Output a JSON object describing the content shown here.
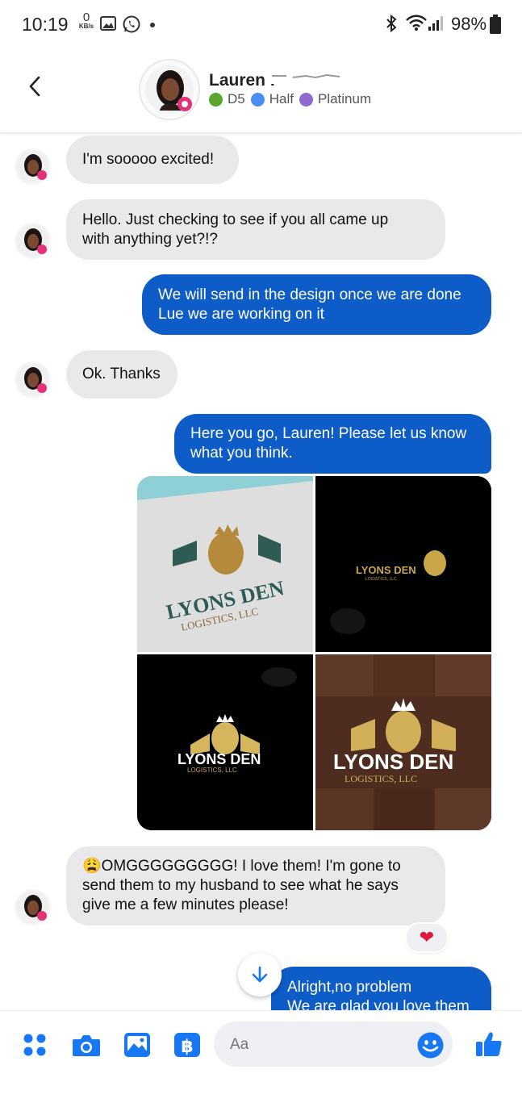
{
  "status_bar": {
    "time": "10:19",
    "net_speed_value": "0",
    "net_speed_unit": "KB/s",
    "battery": "98%"
  },
  "header": {
    "name": "Lauren I",
    "badges": [
      {
        "label": "D5",
        "color": "#58a62c"
      },
      {
        "label": "Half",
        "color": "#4c8df5"
      },
      {
        "label": "Platinum",
        "color": "#8f69d0"
      }
    ]
  },
  "messages": [
    {
      "dir": "in",
      "text": "I'm sooooo excited!"
    },
    {
      "dir": "in",
      "text": "Hello. Just checking to see if you all came up\nwith anything yet?!?"
    },
    {
      "dir": "out",
      "text": "We will send in the design once we are done\nLue we are working on it"
    },
    {
      "dir": "in",
      "text": "Ok. Thanks"
    },
    {
      "dir": "out",
      "text": "Here you go, Lauren! Please let us know\nwhat you think."
    },
    {
      "dir": "in",
      "text": "😩OMGGGGGGGGG! I love them! I'm gone to\nsend them to my husband to see what he says\ngive me a few minutes please!"
    },
    {
      "dir": "out",
      "text": "Alright,no problem\nWe are glad you love them"
    }
  ],
  "photos": {
    "brand_main": "LYONS DEN",
    "brand_sub": "LOGISTICS, LLC"
  },
  "reaction": "❤",
  "composer": {
    "placeholder": "Aa"
  },
  "colors": {
    "outgoing": "#0d5cc7",
    "incoming": "#e9e9eb",
    "accent": "#1877f2"
  },
  "icons": [
    "grid-icon",
    "camera-icon",
    "image-icon",
    "payment-icon",
    "emoji-icon",
    "like-icon",
    "back-icon",
    "scroll-down-icon"
  ]
}
